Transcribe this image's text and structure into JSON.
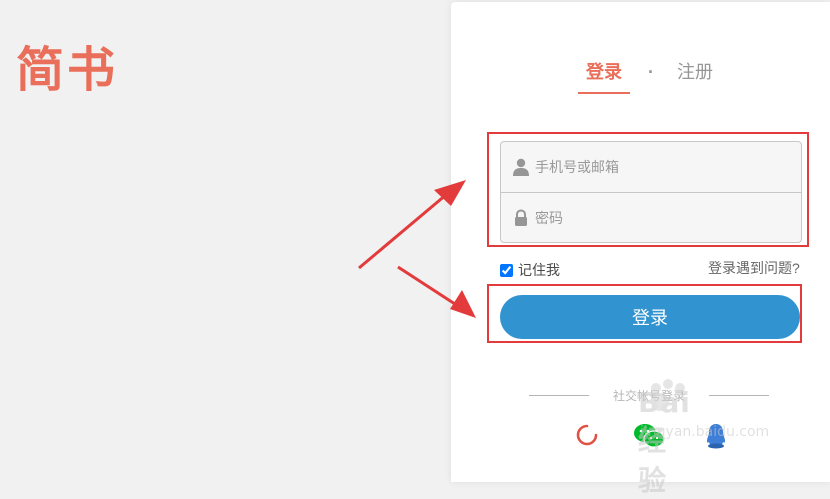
{
  "app": {
    "logo_text": "简书",
    "brand_color": "#ea6f5a",
    "accent_color": "#3194d0"
  },
  "tabs": {
    "login": "登录",
    "separator": "·",
    "register": "注册"
  },
  "form": {
    "username": {
      "placeholder": "手机号或邮箱",
      "icon": "user-icon"
    },
    "password": {
      "placeholder": "密码",
      "icon": "lock-icon"
    },
    "remember_label": "记住我",
    "remember_checked": true,
    "trouble_link": "登录遇到问题?",
    "submit_label": "登录"
  },
  "social": {
    "label": "社交帐号登录",
    "icons": [
      "weibo-icon",
      "wechat-icon",
      "qq-icon"
    ]
  },
  "annotation": {
    "highlight_color": "#e33b3b"
  },
  "watermark": {
    "text": "Bai经验",
    "url": "jingyan.baidu.com"
  }
}
